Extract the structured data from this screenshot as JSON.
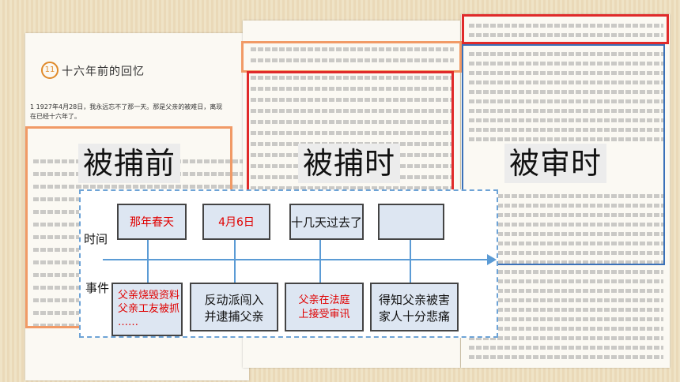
{
  "lesson": {
    "number": "11",
    "title": "十六年前的回忆",
    "first_line": "1  1927年4月28日，我永远忘不了那一天。那是父亲的被难日，离现在已经十六年了。"
  },
  "stage_labels": [
    "被捕前",
    "被捕时",
    "被审时"
  ],
  "timeline": {
    "time_label": "时间",
    "event_label": "事件",
    "times": [
      "那年春天",
      "4月6日",
      "十几天过去了",
      ""
    ],
    "events": [
      {
        "lines": [
          "父亲烧毁资料",
          "父亲工友被抓",
          "……"
        ]
      },
      {
        "lines": [
          "反动派闯入",
          "并逮捕父亲"
        ]
      },
      {
        "lines": [
          "父亲在法庭",
          "上接受审讯"
        ]
      },
      {
        "lines": [
          "得知父亲被害",
          "家人十分悲痛"
        ]
      }
    ]
  },
  "colors": {
    "red_frame": "#e02a2a",
    "orange_frame": "#f19a66",
    "blue_frame": "#3a71b9",
    "axis": "#5b9bd5"
  }
}
